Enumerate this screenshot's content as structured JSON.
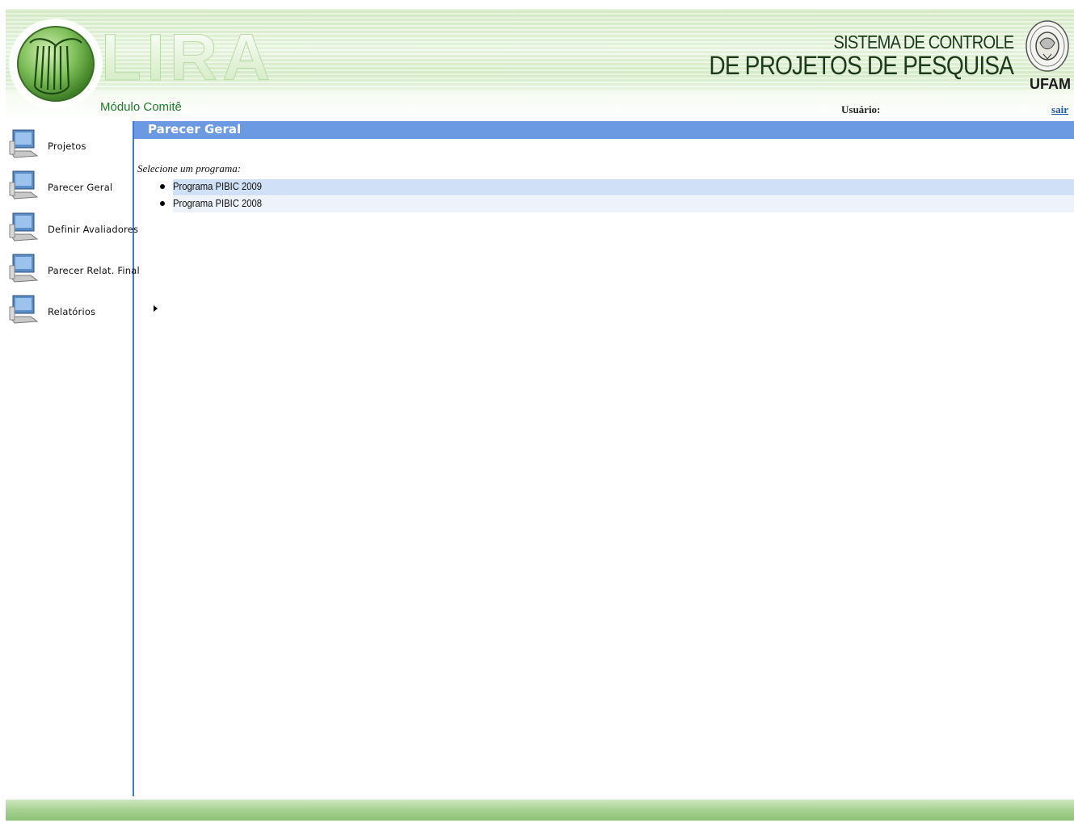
{
  "header": {
    "logo_text": "LIRA",
    "system_title_line1": "SISTEMA DE CONTROLE",
    "system_title_line2": "DE PROJETOS DE PESQUISA",
    "institution": "UFAM",
    "module": "Módulo Comitê",
    "user_label": "Usuário:",
    "logout": "sair"
  },
  "sidebar": {
    "items": [
      {
        "label": "Projetos",
        "icon": "computer-icon"
      },
      {
        "label": "Parecer Geral",
        "icon": "computer-icon"
      },
      {
        "label": "Definir Avaliadores",
        "icon": "computer-icon"
      },
      {
        "label": "Parecer Relat. Final",
        "icon": "computer-icon"
      },
      {
        "label": "Relatórios",
        "icon": "computer-icon"
      }
    ]
  },
  "main": {
    "section_title": "Parecer Geral",
    "prompt": "Selecione um programa:",
    "programs": [
      {
        "label": "Programa PIBIC 2009"
      },
      {
        "label": "Programa PIBIC 2008"
      }
    ],
    "expand_icon": "triangle-right-icon"
  },
  "colors": {
    "header_green": "#d9edcb",
    "module_text": "#1f7a2e",
    "section_bar": "#6b9ae2",
    "sidebar_border": "#3c78d8",
    "row_highlight": "#cfe0f7",
    "row_alt": "#eef3fb",
    "footer_green": "#a9d395",
    "logout_link": "#1f5aa8"
  }
}
